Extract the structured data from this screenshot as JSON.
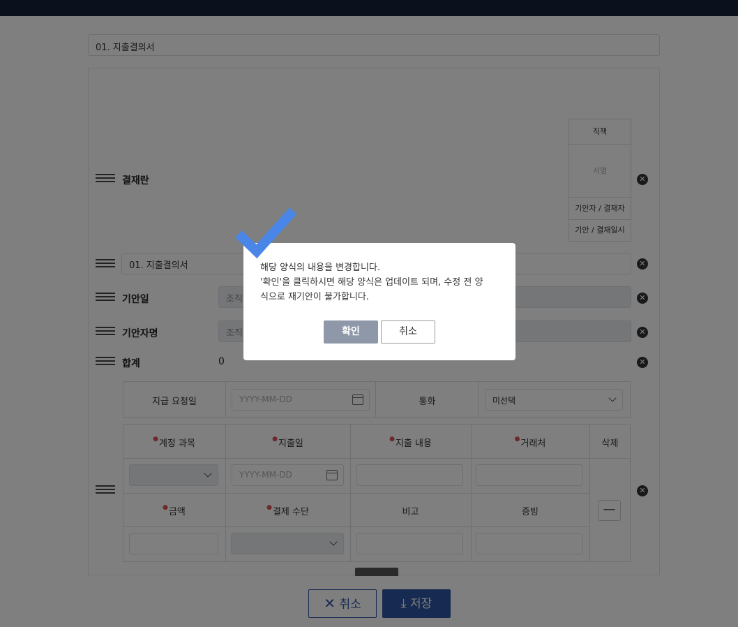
{
  "header": {
    "form_title": "01. 지출결의서"
  },
  "approval": {
    "label": "결재란",
    "cells": [
      "직책",
      "서명",
      "기안자 / 결재자",
      "기안 / 결재일시"
    ]
  },
  "rows": {
    "doc_title_value": "01. 지출결의서",
    "draft_date_label": "기안일",
    "draft_date_value": "조직",
    "drafter_label": "기안자명",
    "drafter_value": "조직",
    "total_label": "합계",
    "total_value": "0"
  },
  "payment": {
    "request_date_label": "지급 요청일",
    "request_date_placeholder": "YYYY-MM-DD",
    "currency_label": "통화",
    "currency_value": "미선택"
  },
  "expense_table": {
    "headers1": [
      "계정 과목",
      "지출일",
      "지출 내용",
      "거래처",
      "삭제"
    ],
    "headers2": [
      "금액",
      "결제 수단",
      "비고",
      "증빙"
    ],
    "date_placeholder": "YYYY-MM-DD",
    "minus_label": "—"
  },
  "bottom": {
    "cancel_label": "취소",
    "save_label": "저장"
  },
  "modal": {
    "line1": "해당 양식의 내용을 변경합니다.",
    "line2": "'확인'을 클릭하시면 해당 양식은 업데이트 되며, 수정 전 양",
    "line3": "식으로 재기안이 불가합니다.",
    "confirm_label": "확인",
    "cancel_label": "취소"
  },
  "colors": {
    "accent": "#2f55a4",
    "check": "#4a86e8",
    "topbar": "#17213a"
  }
}
